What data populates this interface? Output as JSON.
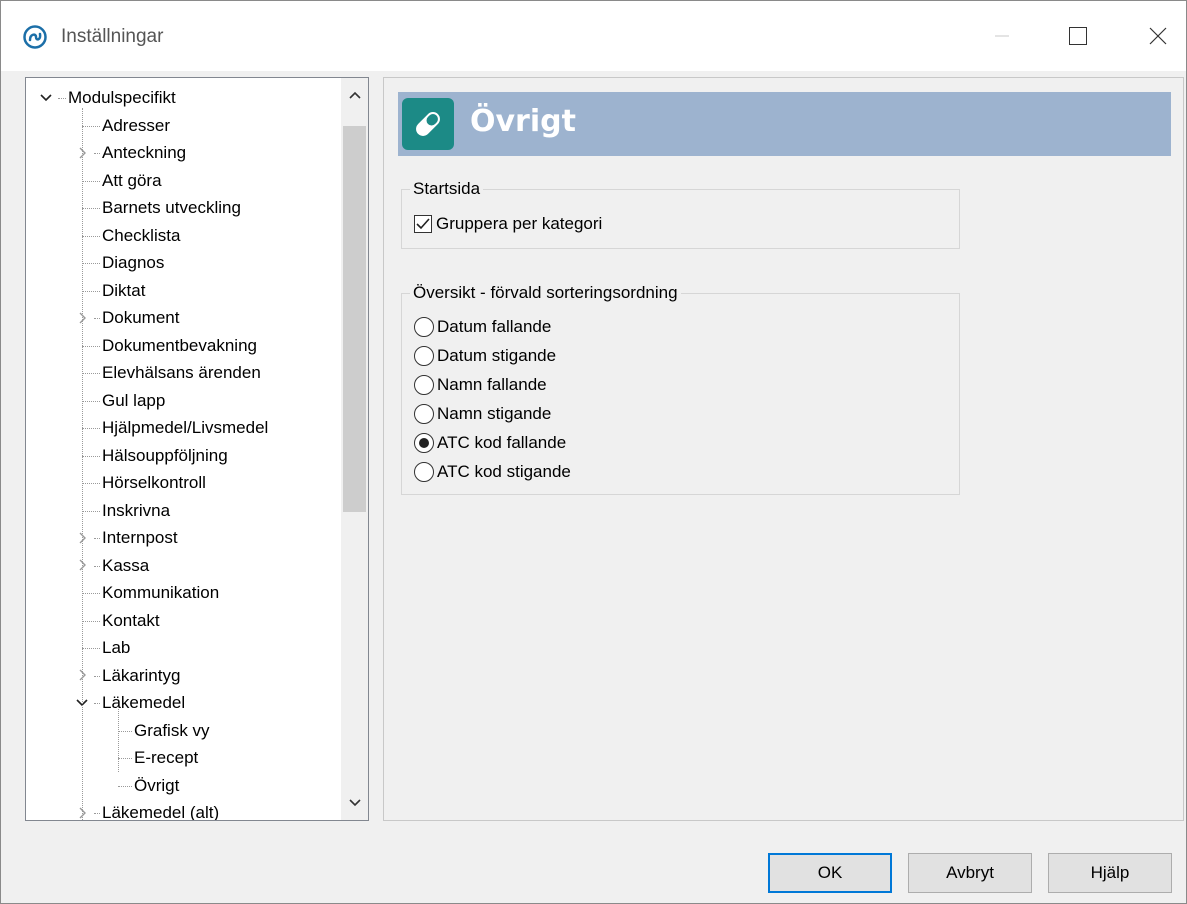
{
  "window": {
    "title": "Inställningar",
    "icon": "app-logo-icon"
  },
  "tree": {
    "items": [
      {
        "label": "Modulspecifikt",
        "level": 0,
        "expander": "expanded"
      },
      {
        "label": "Adresser",
        "level": 1,
        "expander": "none"
      },
      {
        "label": "Anteckning",
        "level": 1,
        "expander": "collapsed"
      },
      {
        "label": "Att göra",
        "level": 1,
        "expander": "none"
      },
      {
        "label": "Barnets utveckling",
        "level": 1,
        "expander": "none"
      },
      {
        "label": "Checklista",
        "level": 1,
        "expander": "none"
      },
      {
        "label": "Diagnos",
        "level": 1,
        "expander": "none"
      },
      {
        "label": "Diktat",
        "level": 1,
        "expander": "none"
      },
      {
        "label": "Dokument",
        "level": 1,
        "expander": "collapsed"
      },
      {
        "label": "Dokumentbevakning",
        "level": 1,
        "expander": "none"
      },
      {
        "label": "Elevhälsans ärenden",
        "level": 1,
        "expander": "none"
      },
      {
        "label": "Gul lapp",
        "level": 1,
        "expander": "none"
      },
      {
        "label": "Hjälpmedel/Livsmedel",
        "level": 1,
        "expander": "none"
      },
      {
        "label": "Hälsouppföljning",
        "level": 1,
        "expander": "none"
      },
      {
        "label": "Hörselkontroll",
        "level": 1,
        "expander": "none"
      },
      {
        "label": "Inskrivna",
        "level": 1,
        "expander": "none"
      },
      {
        "label": "Internpost",
        "level": 1,
        "expander": "collapsed"
      },
      {
        "label": "Kassa",
        "level": 1,
        "expander": "collapsed"
      },
      {
        "label": "Kommunikation",
        "level": 1,
        "expander": "none"
      },
      {
        "label": "Kontakt",
        "level": 1,
        "expander": "none"
      },
      {
        "label": "Lab",
        "level": 1,
        "expander": "none"
      },
      {
        "label": "Läkarintyg",
        "level": 1,
        "expander": "collapsed"
      },
      {
        "label": "Läkemedel",
        "level": 1,
        "expander": "expanded"
      },
      {
        "label": "Grafisk vy",
        "level": 2,
        "expander": "none"
      },
      {
        "label": "E-recept",
        "level": 2,
        "expander": "none"
      },
      {
        "label": "Övrigt",
        "level": 2,
        "expander": "none"
      },
      {
        "label": "Läkemedel (alt)",
        "level": 1,
        "expander": "collapsed"
      }
    ]
  },
  "content": {
    "header_title": "Övrigt",
    "header_icon": "pill-icon",
    "header_color": "#9db3cf",
    "icon_color": "#1c8a86",
    "startsida": {
      "label": "Startsida",
      "checkbox_label": "Gruppera per kategori",
      "checked": true
    },
    "sort": {
      "label": "Översikt - förvald sorteringsordning",
      "options": [
        {
          "label": "Datum fallande",
          "checked": false
        },
        {
          "label": "Datum stigande",
          "checked": false
        },
        {
          "label": "Namn fallande",
          "checked": false
        },
        {
          "label": "Namn stigande",
          "checked": false
        },
        {
          "label": "ATC kod fallande",
          "checked": true
        },
        {
          "label": "ATC kod stigande",
          "checked": false
        }
      ]
    }
  },
  "buttons": {
    "ok": "OK",
    "cancel": "Avbryt",
    "help": "Hjälp"
  }
}
